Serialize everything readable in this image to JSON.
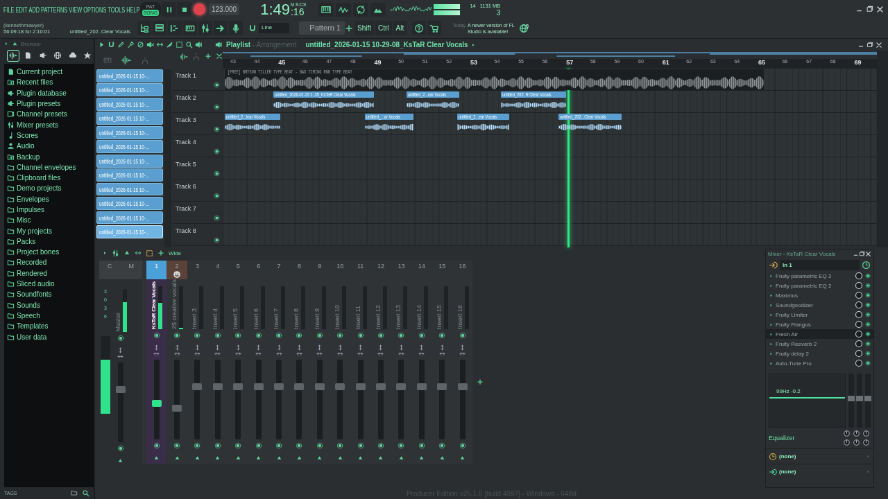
{
  "menu": [
    "FILE",
    "EDIT",
    "ADD",
    "PATTERNS",
    "VIEW",
    "OPTIONS",
    "TOOLS",
    "HELP"
  ],
  "transport": {
    "modes": [
      {
        "label": "PAT",
        "selected": false
      },
      {
        "label": "SONG",
        "selected": true
      }
    ],
    "recording": true,
    "tempo": "123.000",
    "time_units": "M:S:CS",
    "time": "1:49",
    "time_fraction": ":16"
  },
  "monitor": {
    "output_meter": {
      "level": 0.95
    },
    "cpu": "14",
    "memory": "1131 MB",
    "polyphony": "3"
  },
  "hint_bar": {
    "user": "(kennethmawyer)",
    "session_time": "56:09:18 for 2:10:01",
    "hint": "untitled_202..Clear Vocals"
  },
  "toolbar": {
    "snap": "Line",
    "pattern": "Pattern 1",
    "keys": [
      "Shift",
      "Ctrl",
      "Alt"
    ],
    "news_label": "Today",
    "news": "A newer version of FL Studio is available!",
    "news_badge": "5"
  },
  "browser": {
    "title": "Browser",
    "tabs": [
      {
        "kind": "waveform",
        "selected": true
      },
      {
        "kind": "file",
        "selected": false
      },
      {
        "kind": "plug",
        "selected": false
      },
      {
        "kind": "globe",
        "selected": false
      },
      {
        "kind": "cloud",
        "selected": false
      },
      {
        "kind": "star",
        "selected": false
      }
    ],
    "items": [
      {
        "label": "Current project",
        "kind": "file"
      },
      {
        "label": "Recent files",
        "kind": "folder-sync"
      },
      {
        "label": "Plugin database",
        "kind": "plug"
      },
      {
        "label": "Plugin presets",
        "kind": "plug"
      },
      {
        "label": "Channel presets",
        "kind": "channel"
      },
      {
        "label": "Mixer presets",
        "kind": "mixer"
      },
      {
        "label": "Scores",
        "kind": "note"
      },
      {
        "label": "Audio",
        "kind": "person"
      },
      {
        "label": "Backup",
        "kind": "folder-sync"
      },
      {
        "label": "Channel envelopes",
        "kind": "folder"
      },
      {
        "label": "Clipboard files",
        "kind": "folder"
      },
      {
        "label": "Demo projects",
        "kind": "folder"
      },
      {
        "label": "Envelopes",
        "kind": "folder"
      },
      {
        "label": "Impulses",
        "kind": "folder"
      },
      {
        "label": "Misc",
        "kind": "folder"
      },
      {
        "label": "My projects",
        "kind": "folder"
      },
      {
        "label": "Packs",
        "kind": "folder"
      },
      {
        "label": "Project bones",
        "kind": "folder"
      },
      {
        "label": "Recorded",
        "kind": "folder"
      },
      {
        "label": "Rendered",
        "kind": "folder"
      },
      {
        "label": "Sliced audio",
        "kind": "folder"
      },
      {
        "label": "Soundfonts",
        "kind": "folder"
      },
      {
        "label": "Sounds",
        "kind": "folder"
      },
      {
        "label": "Speech",
        "kind": "folder"
      },
      {
        "label": "Templates",
        "kind": "folder"
      },
      {
        "label": "User data",
        "kind": "folder"
      }
    ],
    "tags": "TAGS"
  },
  "playlist": {
    "title": "Playlist",
    "view": "- Arrangement",
    "current_clip": "untitled_2026-01-15 10-29-08_KsTaR Clear Vocals",
    "clip_sources": [
      {
        "label": "untitled_2026-01-15 10-...",
        "selected": false
      },
      {
        "label": "untitled_2026-01-15 10-...",
        "selected": false
      },
      {
        "label": "untitled_2026-01-15 10-...",
        "selected": false
      },
      {
        "label": "untitled_2026-01-15 10-...",
        "selected": false
      },
      {
        "label": "untitled_2026-01-15 10-...",
        "selected": false
      },
      {
        "label": "untitled_2026-01-15 10-...",
        "selected": false
      },
      {
        "label": "untitled_2026-01-15 10-...",
        "selected": false
      },
      {
        "label": "untitled_2026-01-15 10-...",
        "selected": false
      },
      {
        "label": "untitled_2026-01-15 10-...",
        "selected": false
      },
      {
        "label": "untitled_2026-01-15 10-...",
        "selected": false
      },
      {
        "label": "untitled_2026-01-15 10-...",
        "selected": false
      },
      {
        "label": "untitled_2026-01-15 10-...",
        "selected": true
      }
    ],
    "ruler": [
      "43",
      "44",
      "45",
      "46",
      "47",
      "48",
      "49",
      "50",
      "51",
      "52",
      "53",
      "54",
      "55",
      "56",
      "57",
      "58",
      "59",
      "60",
      "61",
      "62",
      "63",
      "64",
      "65",
      "66",
      "67",
      "68",
      "69"
    ],
    "tracks": [
      {
        "name": "Track 1",
        "clips": [
          {
            "label": "[FREE] BRYSON TILLER TYPE BEAT - BAD TIMING  RNB TYPE BEAT",
            "kind": "beat"
          }
        ]
      },
      {
        "name": "Track 2",
        "clips": [
          {
            "label": "untitled_2026-01-15 1..35_KsTaR Clear Vocals",
            "kind": "vocal"
          },
          {
            "label": "untitled_2...ear Vocals",
            "kind": "vocal"
          },
          {
            "label": "untitled_202..R Clear Vocals",
            "kind": "vocal"
          }
        ]
      },
      {
        "name": "Track 3",
        "clips": [
          {
            "label": "untitled_2...lear Vocals",
            "kind": "vocal"
          },
          {
            "label": "untitled_...ar Vocals",
            "kind": "vocal"
          },
          {
            "label": "untitled_2...ear Vocals",
            "kind": "vocal"
          },
          {
            "label": "untitled_202...Clear Vocals",
            "kind": "vocal"
          }
        ]
      },
      {
        "name": "Track 4"
      },
      {
        "name": "Track 5"
      },
      {
        "name": "Track 6"
      },
      {
        "name": "Track 7"
      },
      {
        "name": "Track 8"
      }
    ]
  },
  "mixer": {
    "view": "Wide",
    "current_label": "C",
    "scale": [
      "3",
      "0",
      "3",
      "6"
    ],
    "strips": [
      {
        "number": "M",
        "name": "Master",
        "selected": false,
        "meter": {
          "level": 0.7
        },
        "fader": {
          "level": 0.68
        }
      },
      {
        "number": "1",
        "name": "KsTaR Clear Vocals",
        "selected": true,
        "meter": {
          "level": 0.62
        },
        "fader": {
          "level": 0.45
        }
      },
      {
        "number": "2",
        "name": "2$ creative vocals",
        "selected": false,
        "color": "#5a4238",
        "meter": {
          "level": 0.04
        },
        "fader": {
          "level": 0.38
        }
      },
      {
        "number": "3",
        "name": "Insert 3",
        "selected": false,
        "meter": {
          "level": 0
        },
        "fader": {
          "level": 0.68
        }
      },
      {
        "number": "4",
        "name": "Insert 4",
        "selected": false,
        "meter": {
          "level": 0
        },
        "fader": {
          "level": 0.68
        }
      },
      {
        "number": "5",
        "name": "Insert 5",
        "selected": false,
        "meter": {
          "level": 0
        },
        "fader": {
          "level": 0.68
        }
      },
      {
        "number": "6",
        "name": "Insert 6",
        "selected": false,
        "meter": {
          "level": 0
        },
        "fader": {
          "level": 0.68
        }
      },
      {
        "number": "7",
        "name": "Insert 7",
        "selected": false,
        "meter": {
          "level": 0
        },
        "fader": {
          "level": 0.68
        }
      },
      {
        "number": "8",
        "name": "Insert 8",
        "selected": false,
        "meter": {
          "level": 0
        },
        "fader": {
          "level": 0.68
        }
      },
      {
        "number": "9",
        "name": "Insert 9",
        "selected": false,
        "meter": {
          "level": 0
        },
        "fader": {
          "level": 0.68
        }
      },
      {
        "number": "10",
        "name": "Insert 10",
        "selected": false,
        "meter": {
          "level": 0
        },
        "fader": {
          "level": 0.68
        }
      },
      {
        "number": "11",
        "name": "Insert 11",
        "selected": false,
        "meter": {
          "level": 0
        },
        "fader": {
          "level": 0.68
        }
      },
      {
        "number": "12",
        "name": "Insert 12",
        "selected": false,
        "meter": {
          "level": 0
        },
        "fader": {
          "level": 0.68
        }
      },
      {
        "number": "13",
        "name": "Insert 13",
        "selected": false,
        "meter": {
          "level": 0
        },
        "fader": {
          "level": 0.68
        }
      },
      {
        "number": "14",
        "name": "Insert 14",
        "selected": false,
        "meter": {
          "level": 0
        },
        "fader": {
          "level": 0.68
        }
      },
      {
        "number": "15",
        "name": "Insert 15",
        "selected": false,
        "meter": {
          "level": 0
        },
        "fader": {
          "level": 0.68
        }
      },
      {
        "number": "16",
        "name": "Insert 16",
        "selected": false,
        "meter": {
          "level": 0
        },
        "fader": {
          "level": 0.68
        }
      }
    ]
  },
  "mixer_panel": {
    "title": "Mixer - KsTaR Clear Vocals",
    "input": "In 1",
    "effects": [
      {
        "name": "Fruity parametric EQ 2",
        "selected": false,
        "on": true
      },
      {
        "name": "Fruity parametric EQ 2",
        "selected": false,
        "on": true
      },
      {
        "name": "Maximus",
        "selected": false,
        "on": true
      },
      {
        "name": "Soundgoodizer",
        "selected": false,
        "on": true
      },
      {
        "name": "Fruity Limiter",
        "selected": false,
        "on": true
      },
      {
        "name": "Fruity Flangus",
        "selected": false,
        "on": true
      },
      {
        "name": "Fresh Air",
        "selected": true,
        "on": true
      },
      {
        "name": "Fruity Reeverb 2",
        "selected": false,
        "on": true
      },
      {
        "name": "Fruity delay 2",
        "selected": false,
        "on": true
      },
      {
        "name": "Auto-Tune Pro",
        "selected": false,
        "on": true
      }
    ],
    "eq_readout": "99Hz -0.2",
    "eq_sliders": [
      {
        "level": 0.55
      },
      {
        "level": 0.55
      },
      {
        "level": 0.55
      }
    ],
    "eq_title": "Equalizer",
    "routes": [
      "(none)",
      "(none)"
    ]
  },
  "status_bar": "Producer Edition v25.1.6 [build 4997] - Windows - 64Bit"
}
